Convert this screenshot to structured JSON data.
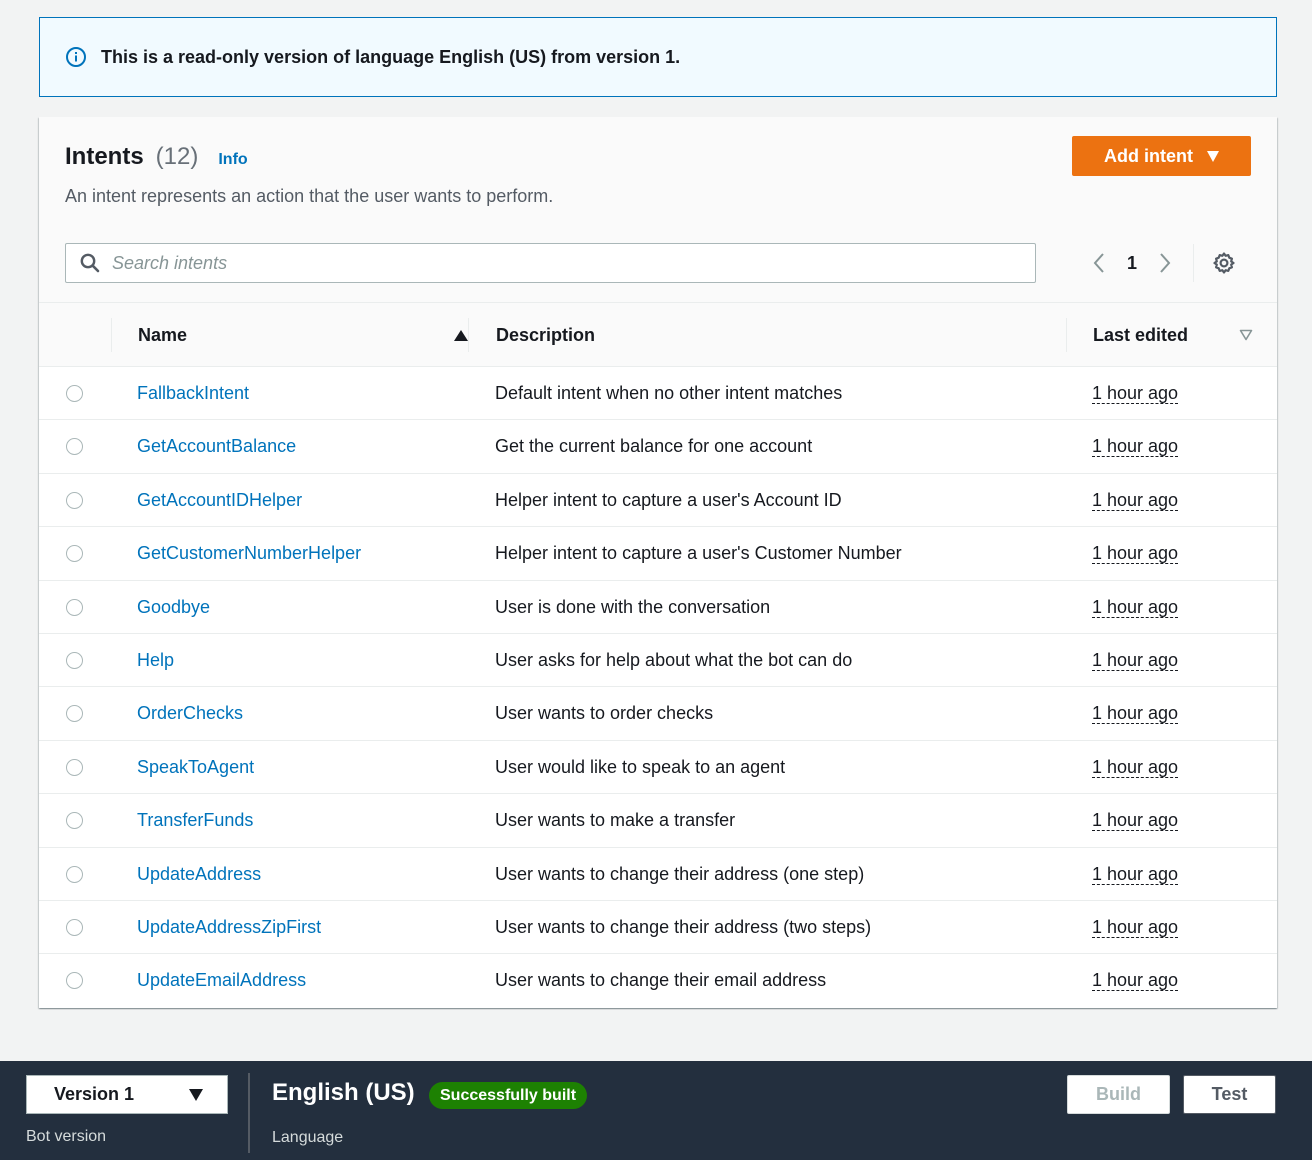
{
  "flash": {
    "icon": "info-circle-icon",
    "message": "This is a read-only version of language English (US) from version 1."
  },
  "panel": {
    "title": "Intents",
    "count": "(12)",
    "info_link": "Info",
    "description": "An intent represents an action that the user wants to perform.",
    "add_button": "Add intent",
    "search_placeholder": "Search intents",
    "current_page": "1"
  },
  "table": {
    "columns": {
      "name": "Name",
      "description": "Description",
      "last_edited": "Last edited"
    },
    "sort": {
      "column": "Name",
      "direction": "ascending"
    },
    "rows": [
      {
        "name": "FallbackIntent",
        "description": "Default intent when no other intent matches",
        "last_edited": "1 hour ago"
      },
      {
        "name": "GetAccountBalance",
        "description": "Get the current balance for one account",
        "last_edited": "1 hour ago"
      },
      {
        "name": "GetAccountIDHelper",
        "description": "Helper intent to capture a user's Account ID",
        "last_edited": "1 hour ago"
      },
      {
        "name": "GetCustomerNumberHelper",
        "description": "Helper intent to capture a user's Customer Number",
        "last_edited": "1 hour ago"
      },
      {
        "name": "Goodbye",
        "description": "User is done with the conversation",
        "last_edited": "1 hour ago"
      },
      {
        "name": "Help",
        "description": "User asks for help about what the bot can do",
        "last_edited": "1 hour ago"
      },
      {
        "name": "OrderChecks",
        "description": "User wants to order checks",
        "last_edited": "1 hour ago"
      },
      {
        "name": "SpeakToAgent",
        "description": "User would like to speak to an agent",
        "last_edited": "1 hour ago"
      },
      {
        "name": "TransferFunds",
        "description": "User wants to make a transfer",
        "last_edited": "1 hour ago"
      },
      {
        "name": "UpdateAddress",
        "description": "User wants to change their address (one step)",
        "last_edited": "1 hour ago"
      },
      {
        "name": "UpdateAddressZipFirst",
        "description": "User wants to change their address (two steps)",
        "last_edited": "1 hour ago"
      },
      {
        "name": "UpdateEmailAddress",
        "description": "User wants to change their email address",
        "last_edited": "1 hour ago"
      }
    ]
  },
  "footer": {
    "version_select": "Version 1",
    "version_label": "Bot version",
    "language": "English (US)",
    "status_badge": "Successfully built",
    "language_label": "Language",
    "build_button": "Build",
    "test_button": "Test"
  },
  "colors": {
    "accent_link": "#0073bb",
    "primary_button": "#ec7211",
    "success_badge": "#1d8102",
    "footer_bg": "#232f3e"
  }
}
